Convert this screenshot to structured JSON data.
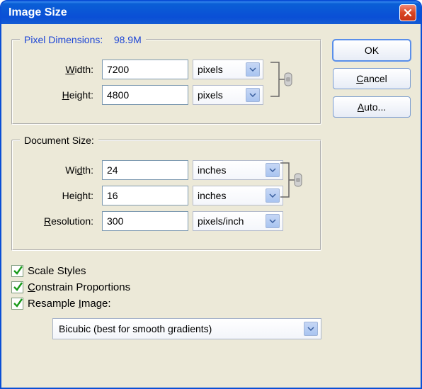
{
  "title": "Image Size",
  "buttons": {
    "ok": "OK",
    "cancel": "Cancel",
    "auto": "Auto..."
  },
  "pixel_dimensions": {
    "legend_prefix": "Pixel Dimensions:",
    "size_text": "98.9M",
    "width_label": "Width:",
    "width_value": "7200",
    "width_unit": "pixels",
    "height_label": "Height:",
    "height_value": "4800",
    "height_unit": "pixels"
  },
  "document_size": {
    "legend": "Document Size:",
    "width_label": "Width:",
    "width_value": "24",
    "width_unit": "inches",
    "height_label": "Height:",
    "height_value": "16",
    "height_unit": "inches",
    "resolution_label": "Resolution:",
    "resolution_value": "300",
    "resolution_unit": "pixels/inch"
  },
  "checkboxes": {
    "scale_styles": "Scale Styles",
    "constrain_pref": "C",
    "constrain_rest": "onstrain Proportions",
    "resample_pref": "Resample ",
    "resample_under": "I",
    "resample_rest": "mage:"
  },
  "resample_method": "Bicubic (best for smooth gradients)",
  "auto_under": "A",
  "auto_rest": "uto...",
  "cancel_under": "C",
  "cancel_rest": "ancel",
  "res_under": "R",
  "res_rest": "esolution:",
  "height_under": "H",
  "height_rest": "eight:",
  "width_under": "W",
  "width_rest": "idth:"
}
